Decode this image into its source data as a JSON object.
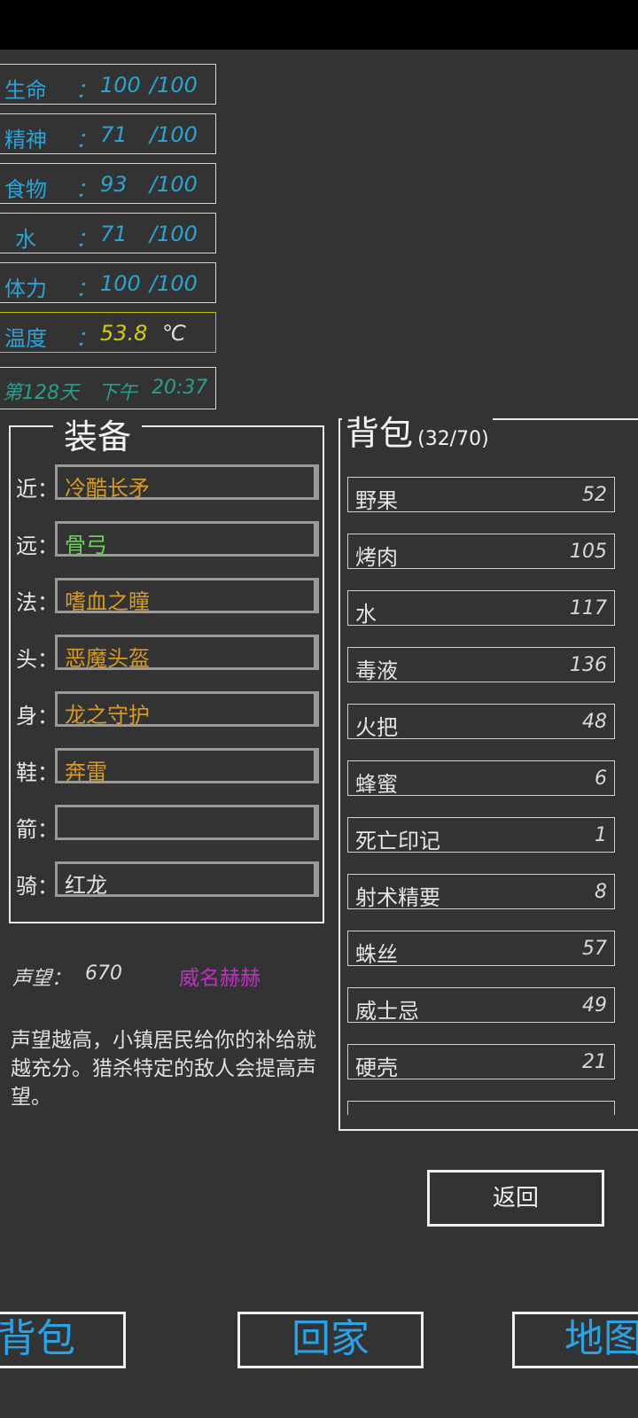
{
  "stats": [
    {
      "label": "生命",
      "colon": "：",
      "value": "100",
      "max": "/100"
    },
    {
      "label": "精神",
      "colon": "：",
      "value": "71",
      "max": "/100"
    },
    {
      "label": "食物",
      "colon": "：",
      "value": "93",
      "max": "/100"
    },
    {
      "label": "水",
      "colon": "：",
      "value": "71",
      "max": "/100"
    },
    {
      "label": "体力",
      "colon": "：",
      "value": "100",
      "max": "/100"
    },
    {
      "label": "温度",
      "colon": "：",
      "value": "53.8",
      "max": "℃"
    }
  ],
  "day": {
    "day": "第128天",
    "period": "下午",
    "time": "20:37"
  },
  "equipment": {
    "title": "装备",
    "slots": [
      {
        "label": "近：",
        "item": "冷酷长矛",
        "color": "#d79a24"
      },
      {
        "label": "远：",
        "item": "骨弓",
        "color": "#6ccf5a"
      },
      {
        "label": "法：",
        "item": "嗜血之瞳",
        "color": "#d79a24"
      },
      {
        "label": "头：",
        "item": "恶魔头盔",
        "color": "#d79a24"
      },
      {
        "label": "身：",
        "item": "龙之守护",
        "color": "#d79a24"
      },
      {
        "label": "鞋：",
        "item": "奔雷",
        "color": "#d79a24"
      },
      {
        "label": "箭：",
        "item": "",
        "color": "#e4e4e4"
      },
      {
        "label": "骑：",
        "item": "红龙",
        "color": "#e4e4e4"
      }
    ]
  },
  "reputation": {
    "label": "声望：",
    "value": "670",
    "title": "威名赫赫",
    "title_color": "#c030c8",
    "description": "声望越高，小镇居民给你的补给就越充分。猎杀特定的敌人会提高声望。"
  },
  "bag": {
    "title": "背包",
    "count": "(32/70)",
    "items": [
      {
        "name": "野果",
        "qty": "52"
      },
      {
        "name": "烤肉",
        "qty": "105"
      },
      {
        "name": "水",
        "qty": "117"
      },
      {
        "name": "毒液",
        "qty": "136"
      },
      {
        "name": "火把",
        "qty": "48"
      },
      {
        "name": "蜂蜜",
        "qty": "6"
      },
      {
        "name": "死亡印记",
        "qty": "1"
      },
      {
        "name": "射术精要",
        "qty": "8"
      },
      {
        "name": "蛛丝",
        "qty": "57"
      },
      {
        "name": "威士忌",
        "qty": "49"
      },
      {
        "name": "硬壳",
        "qty": "21"
      }
    ]
  },
  "buttons": {
    "back": "返回"
  },
  "nav": {
    "bag": "背包",
    "home": "回家",
    "map": "地图"
  }
}
